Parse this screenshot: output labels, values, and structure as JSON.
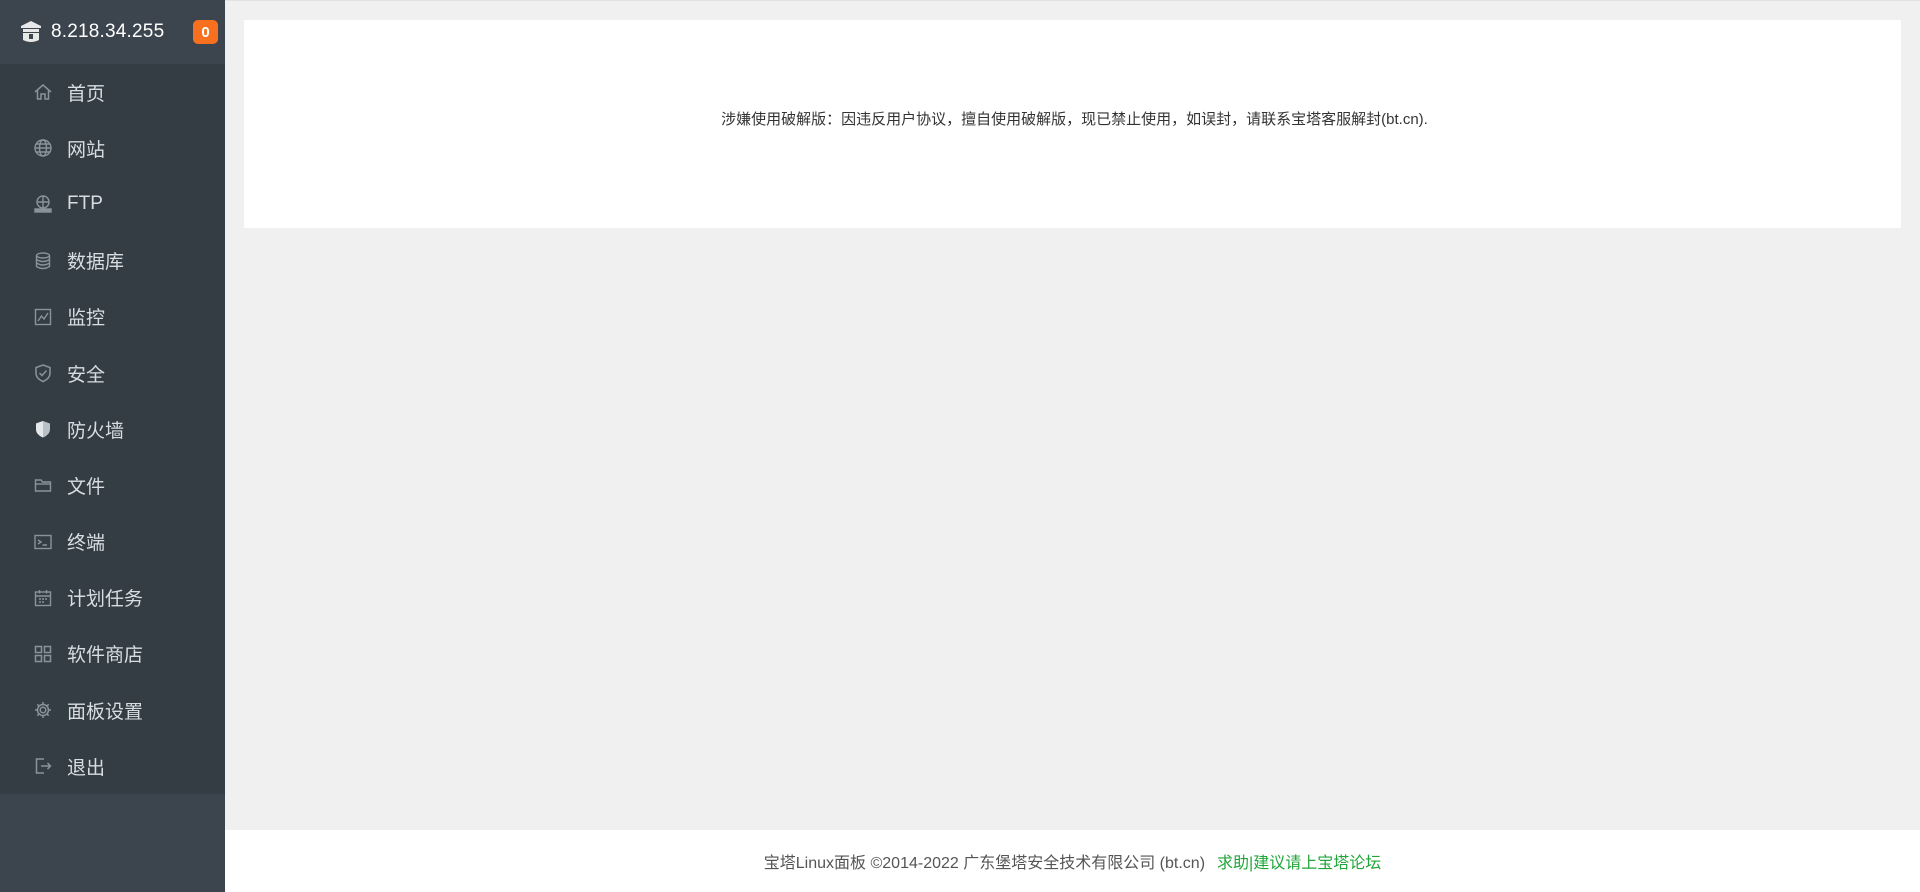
{
  "sidebar": {
    "server_ip": "8.218.34.255",
    "message_count": "0",
    "logo_icon": "bt-panel-logo-icon",
    "items": [
      {
        "label": "首页",
        "icon": "home-icon"
      },
      {
        "label": "网站",
        "icon": "globe-icon"
      },
      {
        "label": "FTP",
        "icon": "ftp-icon"
      },
      {
        "label": "数据库",
        "icon": "database-icon"
      },
      {
        "label": "监控",
        "icon": "monitor-icon"
      },
      {
        "label": "安全",
        "icon": "shield-check-icon"
      },
      {
        "label": "防火墙",
        "icon": "firewall-shield-icon"
      },
      {
        "label": "文件",
        "icon": "folder-icon"
      },
      {
        "label": "终端",
        "icon": "terminal-icon"
      },
      {
        "label": "计划任务",
        "icon": "calendar-icon"
      },
      {
        "label": "软件商店",
        "icon": "grid-icon"
      },
      {
        "label": "面板设置",
        "icon": "gear-icon"
      },
      {
        "label": "退出",
        "icon": "logout-icon"
      }
    ]
  },
  "main": {
    "notice": "涉嫌使用破解版：因违反用户协议，擅自使用破解版，现已禁止使用，如误封，请联系宝塔客服解封(bt.cn)."
  },
  "footer": {
    "copyright": "宝塔Linux面板 ©2014-2022 广东堡塔安全技术有限公司 (bt.cn)",
    "forum_link": "求助|建议请上宝塔论坛"
  },
  "colors": {
    "sidebar_bg": "#3c444d",
    "menu_bg": "#353d44",
    "badge": "#f7701f",
    "link_green": "#20a53a",
    "content_bg": "#f0f0f0"
  }
}
